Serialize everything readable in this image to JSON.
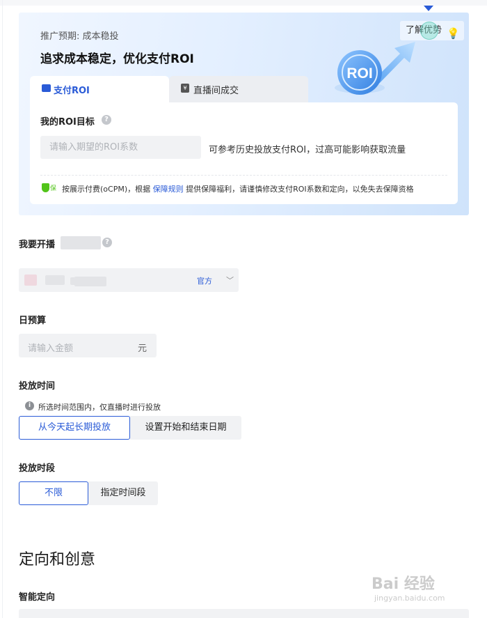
{
  "hero": {
    "subtitle": "推广预期: 成本稳投",
    "title": "追求成本稳定，优化支付ROI",
    "learn_label": "了解优势",
    "art_text": "ROI",
    "tabs": [
      {
        "label": "支付ROI",
        "icon": "wallet-icon",
        "active": true
      },
      {
        "label": "直播间成交",
        "icon": "yen-bag-icon",
        "active": false
      }
    ],
    "roi_target_label": "我的ROI目标",
    "roi_placeholder": "请输入期望的ROI系数",
    "roi_hint": "可参考历史投放支付ROI，过高可能影响获取流量",
    "shield_text": "保",
    "guarantee_prefix": "按展示付费(oCPM)，根据",
    "guarantee_link": "保障规则",
    "guarantee_suffix": "提供保障福利，请谨慎修改支付ROI系数和定向，以免失去保障资格"
  },
  "form": {
    "account_label": "我要开播",
    "account_tag": "官方",
    "budget_label": "日预算",
    "budget_placeholder": "请输入金额",
    "budget_unit": "元",
    "time_label": "投放时间",
    "time_info": "所选时间范围内，仅直播时进行投放",
    "time_options": [
      "从今天起长期投放",
      "设置开始和结束日期"
    ],
    "period_label": "投放时段",
    "period_options": [
      "不限",
      "指定时间段"
    ]
  },
  "targeting": {
    "section_title": "定向和创意",
    "smart_label": "智能定向"
  },
  "watermark": {
    "brand": "Bai 经验",
    "url": "jingyan.baidu.com"
  },
  "colors": {
    "accent": "#2a5bd7",
    "success": "#52c41a",
    "field_bg": "#f1f2f4"
  }
}
